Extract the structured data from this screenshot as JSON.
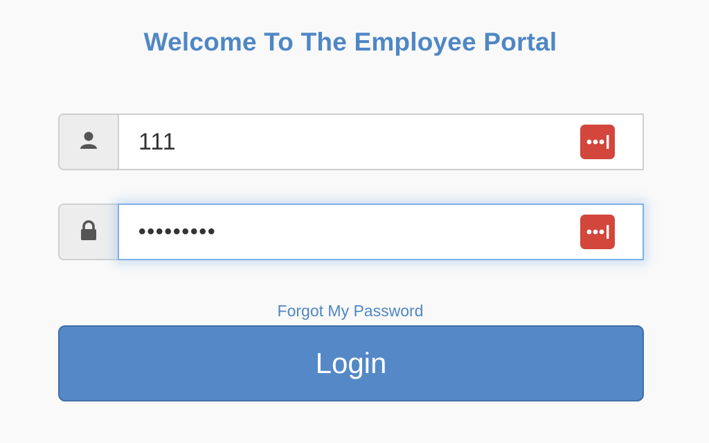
{
  "header": {
    "title": "Welcome To The Employee Portal"
  },
  "form": {
    "username": {
      "value": "111",
      "icon": "user-icon"
    },
    "password": {
      "value": "•••••••••",
      "icon": "lock-icon",
      "focused": true
    },
    "password_manager_icon": "password-manager-icon",
    "forgot_link": "Forgot My Password",
    "login_label": "Login"
  },
  "colors": {
    "accent": "#4f87c5",
    "button": "#5588c6",
    "password_manager": "#d2463c",
    "addon_bg": "#ededed"
  }
}
